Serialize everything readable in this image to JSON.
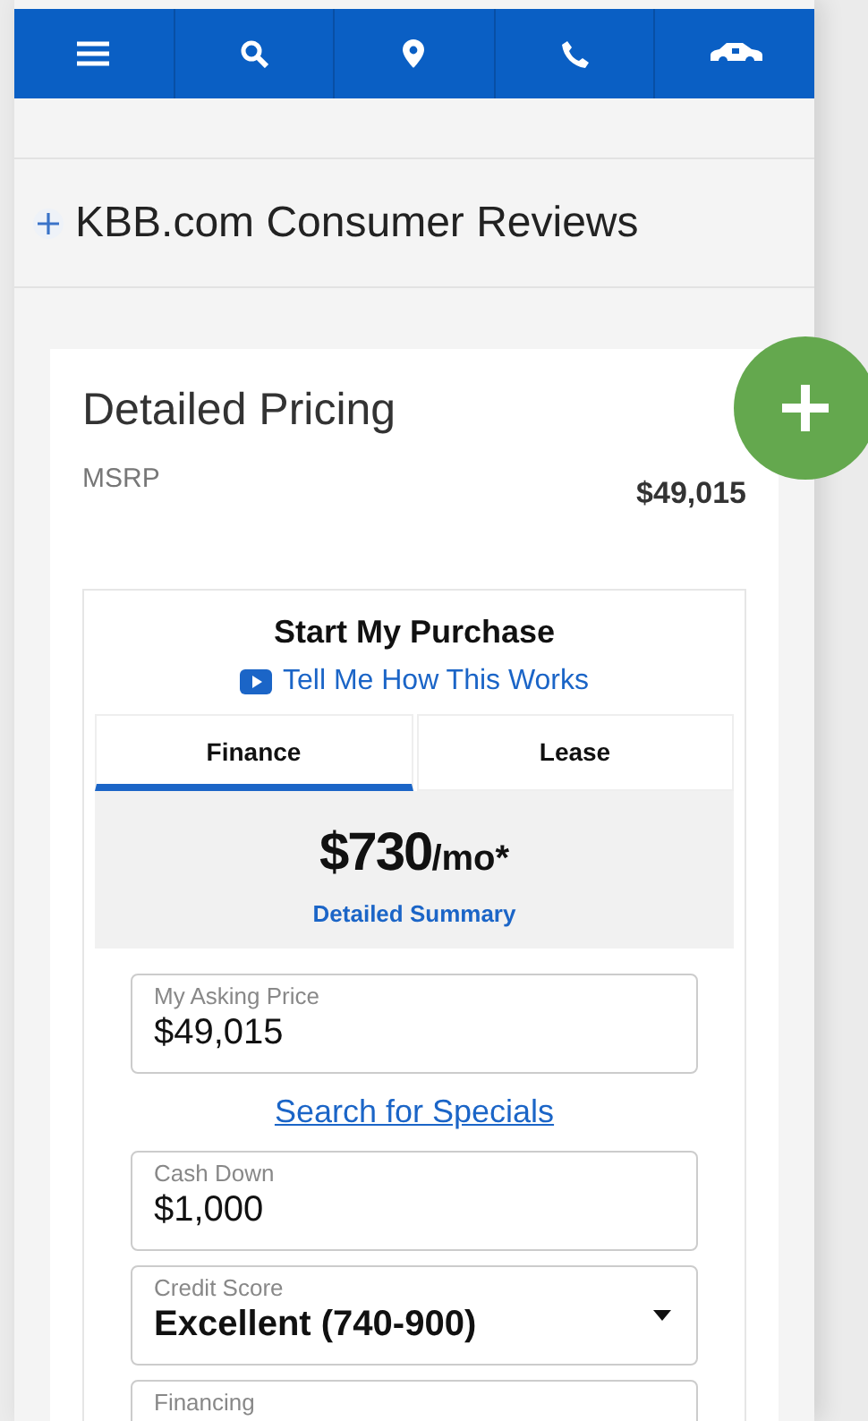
{
  "nav": [
    {
      "kind": "menu"
    },
    {
      "kind": "search"
    },
    {
      "kind": "location"
    },
    {
      "kind": "phone"
    },
    {
      "kind": "car"
    }
  ],
  "sections": [
    {
      "label": "KBB.com Consumer Reviews"
    }
  ],
  "pricing": {
    "title": "Detailed Pricing",
    "msrp_label": "MSRP",
    "msrp_value": "$49,015",
    "purchase": {
      "title": "Start My Purchase",
      "video_link": "Tell Me How This Works",
      "tabs": [
        {
          "label": "Finance",
          "selected": true
        },
        {
          "label": "Lease",
          "selected": false
        }
      ],
      "payment": "$730",
      "payment_unit": "/mo*",
      "summary_link": "Detailed Summary",
      "fields": [
        {
          "kind": "input",
          "label": "My Asking Price",
          "value": "$49,015"
        },
        {
          "kind": "link",
          "label": "Search for Specials"
        },
        {
          "kind": "input",
          "label": "Cash Down",
          "value": "$1,000"
        },
        {
          "kind": "select",
          "label": "Credit Score",
          "value": "Excellent (740-900)"
        },
        {
          "kind": "input",
          "label": "Financing"
        }
      ]
    }
  }
}
